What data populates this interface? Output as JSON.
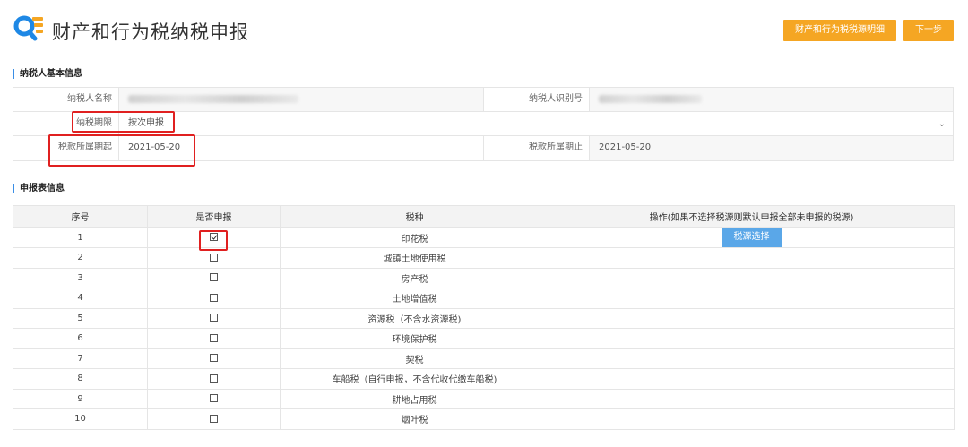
{
  "header": {
    "title": "财产和行为税纳税申报",
    "detail_button": "财产和行为税税源明细",
    "next_button": "下一步"
  },
  "sections": {
    "basic_info": "纳税人基本信息",
    "declaration": "申报表信息"
  },
  "basic_info": {
    "taxpayer_name_label": "纳税人名称",
    "taxpayer_id_label": "纳税人识别号",
    "period_type_label": "纳税期限",
    "period_type_value": "按次申报",
    "period_start_label": "税款所属期起",
    "period_start_value": "2021-05-20",
    "period_end_label": "税款所属期止",
    "period_end_value": "2021-05-20"
  },
  "table": {
    "headers": [
      "序号",
      "是否申报",
      "税种",
      "操作(如果不选择税源则默认申报全部未申报的税源)"
    ],
    "source_button": "税源选择",
    "rows": [
      {
        "no": "1",
        "checked": true,
        "tax": "印花税"
      },
      {
        "no": "2",
        "checked": false,
        "tax": "城镇土地使用税"
      },
      {
        "no": "3",
        "checked": false,
        "tax": "房产税"
      },
      {
        "no": "4",
        "checked": false,
        "tax": "土地增值税"
      },
      {
        "no": "5",
        "checked": false,
        "tax": "资源税（不含水资源税)"
      },
      {
        "no": "6",
        "checked": false,
        "tax": "环境保护税"
      },
      {
        "no": "7",
        "checked": false,
        "tax": "契税"
      },
      {
        "no": "8",
        "checked": false,
        "tax": "车船税（自行申报，不含代收代缴车船税)"
      },
      {
        "no": "9",
        "checked": false,
        "tax": "耕地占用税"
      },
      {
        "no": "10",
        "checked": false,
        "tax": "烟叶税"
      }
    ]
  },
  "colors": {
    "accent_orange": "#f5a623",
    "button_blue": "#5aa7e8",
    "highlight_red": "#e02020"
  }
}
